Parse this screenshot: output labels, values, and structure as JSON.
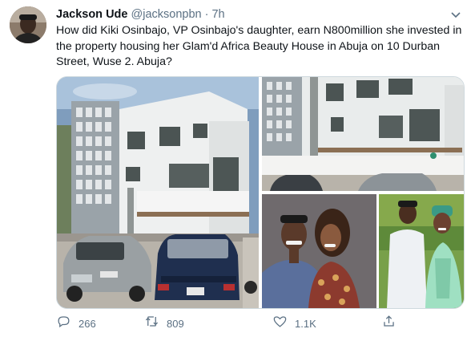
{
  "tweet": {
    "author_name": "Jackson Ude",
    "handle": "@jacksonpbn",
    "separator": "·",
    "time": "7h",
    "text": "How did Kiki Osinbajo, VP Osinbajo's daughter, earn N800million she invested in the property housing her Glam'd Africa Beauty House in Abuja on 10 Durban Street, Wuse 2. Abuja?",
    "icons": {
      "menu": "chevron-down-icon",
      "reply": "reply-icon",
      "retweet": "retweet-icon",
      "like": "heart-icon",
      "share": "share-icon"
    }
  },
  "stats": {
    "replies": "266",
    "retweets": "809",
    "likes": "1.1K"
  },
  "colors": {
    "text": "#0f1419",
    "secondary": "#5b7083",
    "border": "#cfd9de",
    "background": "#ffffff"
  }
}
